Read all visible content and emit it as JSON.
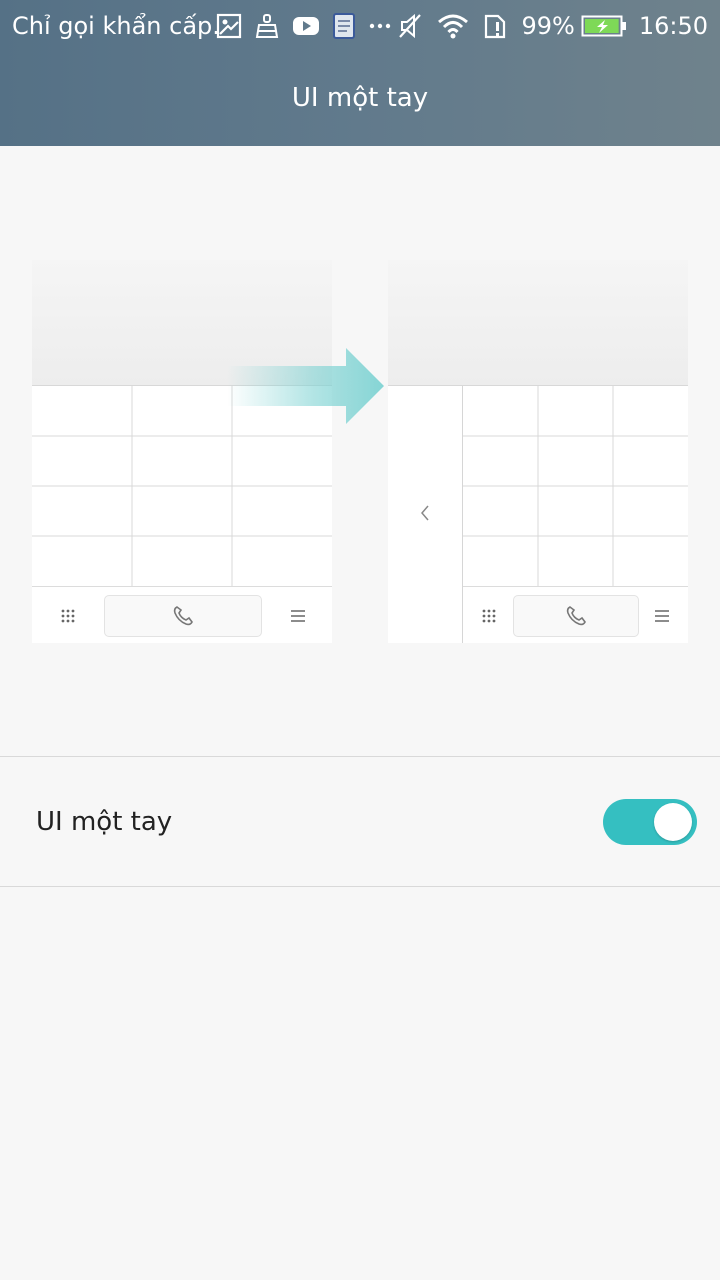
{
  "status_bar": {
    "carrier_text": "Chỉ gọi khẩn cấp.",
    "left_icons": [
      "gallery-icon",
      "cleaner-icon",
      "youtube-icon",
      "notes-icon",
      "more-dots-icon"
    ],
    "right_icons": [
      "mute-icon",
      "wifi-icon",
      "sim-alert-icon"
    ],
    "battery_percent": "99%",
    "battery_level": 0.99,
    "time": "16:50"
  },
  "header": {
    "title": "UI một tay"
  },
  "illustration": {
    "from_phone": "normal-layout",
    "to_phone": "one-hand-layout",
    "accent_color": "#7fd3d3"
  },
  "setting": {
    "label": "UI một tay",
    "enabled": true,
    "toggle_color": "#35bfc1"
  }
}
